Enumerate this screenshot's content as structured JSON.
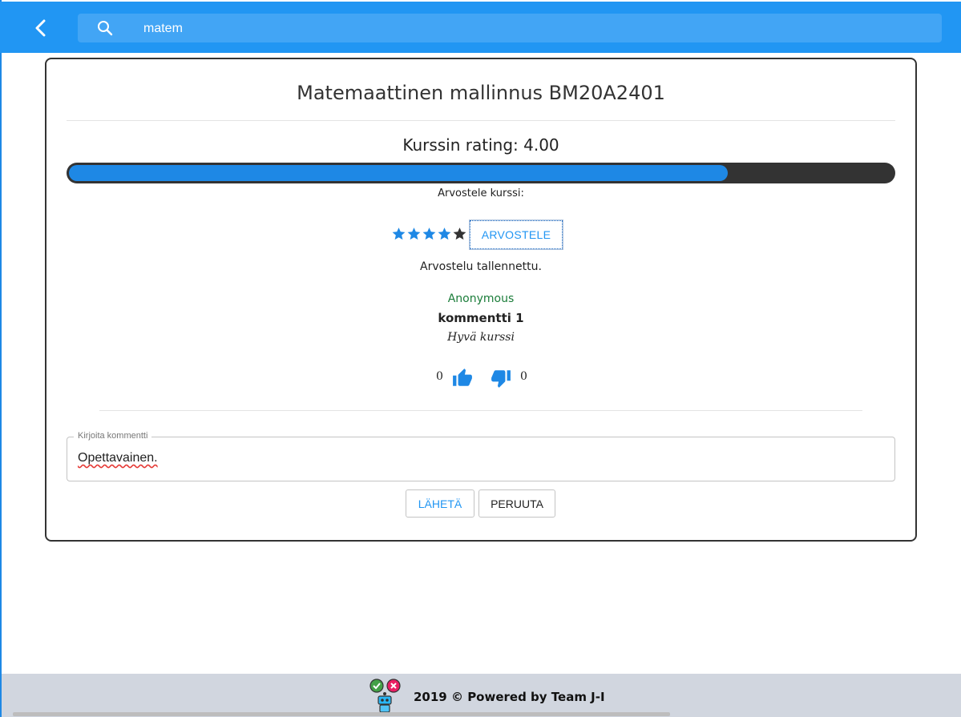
{
  "header": {
    "search_value": "matem",
    "icons": [
      "arrow-back-icon",
      "search-icon"
    ],
    "color": "#2196f3"
  },
  "course": {
    "title": "Matemaattinen mallinnus BM20A2401",
    "rating_label": "Kurssin rating: 4.00",
    "rating_fraction": 0.8,
    "rate_prompt": "Arvostele kurssi:",
    "user_stars": 4,
    "max_stars": 5,
    "rate_button": "ARVOSTELE",
    "saved_message": "Arvostelu tallennettu."
  },
  "comments": [
    {
      "author": "Anonymous",
      "title": "kommentti 1",
      "body": "Hyvä kurssi",
      "upvotes": "0",
      "downvotes": "0"
    }
  ],
  "comment_form": {
    "label": "Kirjoita kommentti",
    "value": "Opettavainen.",
    "send_label": "LÄHETÄ",
    "cancel_label": "PERUUTA"
  },
  "footer": {
    "text": "2019 © Powered by Team J-I"
  },
  "colors": {
    "primary": "#2196f3",
    "star_active": "#1e88e5",
    "star_inactive": "#333333",
    "author": "#1b7d3a"
  }
}
